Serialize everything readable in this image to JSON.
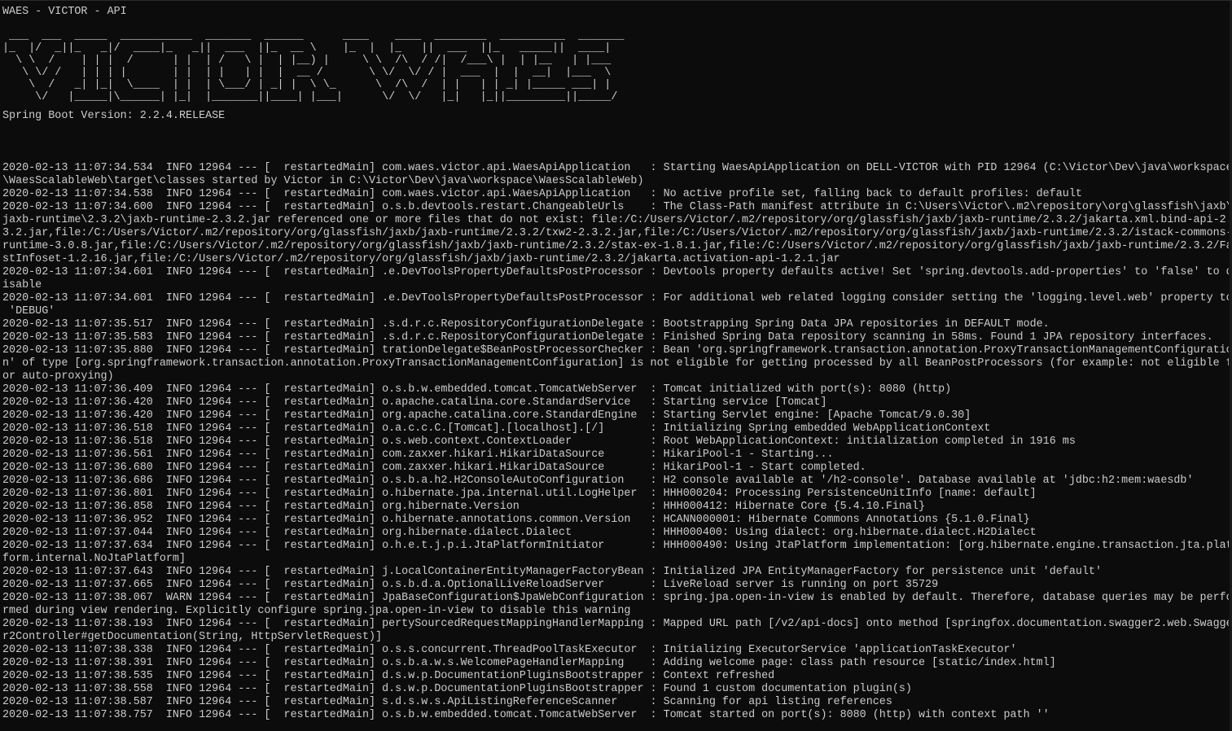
{
  "console": {
    "title": "WAES - VICTOR - API",
    "banner": [
      " ___  ___  _____  ___________  _______  ______      ____    ____  ________  __________  _______ ",
      "|_  |/  _||_   _|/  ____|_   _||  ___  ||_  __ \\    |_  |  |_   ||  ___  ||_   _____||  ____|",
      "  \\ \\  /    | | |  /      | |  | /   \\ |  | |__) |     \\ \\  /\\  / /|  /___\\ |  | |__   | |___  ",
      "   \\ \\/ /   | | | |       | |  | |   | |  |  __ /       \\ \\/  \\/ / |  ___  |  |  __|  |___  \\ ",
      "    \\  /   _| |_|  \\____  | |  | \\___/ | _| |  \\ \\_      \\  /\\  /  | |   | | _| |_____ ___| | ",
      "     \\/   |_____|\\______| |_|  |_______||____| |___|      \\/  \\/   |_|   |_||_________||_____/ "
    ],
    "version": "Spring Boot Version: 2.2.4.RELEASE",
    "log_lines": [
      "2020-02-13 11:07:34.534  INFO 12964 --- [  restartedMain] com.waes.victor.api.WaesApiApplication   : Starting WaesApiApplication on DELL-VICTOR with PID 12964 (C:\\Victor\\Dev\\java\\workspace",
      "\\WaesScalableWeb\\target\\classes started by Victor in C:\\Victor\\Dev\\java\\workspace\\WaesScalableWeb)",
      "2020-02-13 11:07:34.538  INFO 12964 --- [  restartedMain] com.waes.victor.api.WaesApiApplication   : No active profile set, falling back to default profiles: default",
      "2020-02-13 11:07:34.600  INFO 12964 --- [  restartedMain] o.s.b.devtools.restart.ChangeableUrls    : The Class-Path manifest attribute in C:\\Users\\Victor\\.m2\\repository\\org\\glassfish\\jaxb\\",
      "jaxb-runtime\\2.3.2\\jaxb-runtime-2.3.2.jar referenced one or more files that do not exist: file:/C:/Users/Victor/.m2/repository/org/glassfish/jaxb/jaxb-runtime/2.3.2/jakarta.xml.bind-api-2.",
      "3.2.jar,file:/C:/Users/Victor/.m2/repository/org/glassfish/jaxb/jaxb-runtime/2.3.2/txw2-2.3.2.jar,file:/C:/Users/Victor/.m2/repository/org/glassfish/jaxb/jaxb-runtime/2.3.2/istack-commons-",
      "runtime-3.0.8.jar,file:/C:/Users/Victor/.m2/repository/org/glassfish/jaxb/jaxb-runtime/2.3.2/stax-ex-1.8.1.jar,file:/C:/Users/Victor/.m2/repository/org/glassfish/jaxb/jaxb-runtime/2.3.2/Fa",
      "stInfoset-1.2.16.jar,file:/C:/Users/Victor/.m2/repository/org/glassfish/jaxb/jaxb-runtime/2.3.2/jakarta.activation-api-1.2.1.jar",
      "2020-02-13 11:07:34.601  INFO 12964 --- [  restartedMain] .e.DevToolsPropertyDefaultsPostProcessor : Devtools property defaults active! Set 'spring.devtools.add-properties' to 'false' to d",
      "isable",
      "2020-02-13 11:07:34.601  INFO 12964 --- [  restartedMain] .e.DevToolsPropertyDefaultsPostProcessor : For additional web related logging consider setting the 'logging.level.web' property to",
      " 'DEBUG'",
      "2020-02-13 11:07:35.517  INFO 12964 --- [  restartedMain] .s.d.r.c.RepositoryConfigurationDelegate : Bootstrapping Spring Data JPA repositories in DEFAULT mode.",
      "2020-02-13 11:07:35.583  INFO 12964 --- [  restartedMain] .s.d.r.c.RepositoryConfigurationDelegate : Finished Spring Data repository scanning in 58ms. Found 1 JPA repository interfaces.",
      "2020-02-13 11:07:35.880  INFO 12964 --- [  restartedMain] trationDelegate$BeanPostProcessorChecker : Bean 'org.springframework.transaction.annotation.ProxyTransactionManagementConfiguratio",
      "n' of type [org.springframework.transaction.annotation.ProxyTransactionManagementConfiguration] is not eligible for getting processed by all BeanPostProcessors (for example: not eligible f",
      "or auto-proxying)",
      "2020-02-13 11:07:36.409  INFO 12964 --- [  restartedMain] o.s.b.w.embedded.tomcat.TomcatWebServer  : Tomcat initialized with port(s): 8080 (http)",
      "2020-02-13 11:07:36.420  INFO 12964 --- [  restartedMain] o.apache.catalina.core.StandardService   : Starting service [Tomcat]",
      "2020-02-13 11:07:36.420  INFO 12964 --- [  restartedMain] org.apache.catalina.core.StandardEngine  : Starting Servlet engine: [Apache Tomcat/9.0.30]",
      "2020-02-13 11:07:36.518  INFO 12964 --- [  restartedMain] o.a.c.c.C.[Tomcat].[localhost].[/]       : Initializing Spring embedded WebApplicationContext",
      "2020-02-13 11:07:36.518  INFO 12964 --- [  restartedMain] o.s.web.context.ContextLoader            : Root WebApplicationContext: initialization completed in 1916 ms",
      "2020-02-13 11:07:36.561  INFO 12964 --- [  restartedMain] com.zaxxer.hikari.HikariDataSource       : HikariPool-1 - Starting...",
      "2020-02-13 11:07:36.680  INFO 12964 --- [  restartedMain] com.zaxxer.hikari.HikariDataSource       : HikariPool-1 - Start completed.",
      "2020-02-13 11:07:36.686  INFO 12964 --- [  restartedMain] o.s.b.a.h2.H2ConsoleAutoConfiguration    : H2 console available at '/h2-console'. Database available at 'jdbc:h2:mem:waesdb'",
      "2020-02-13 11:07:36.801  INFO 12964 --- [  restartedMain] o.hibernate.jpa.internal.util.LogHelper  : HHH000204: Processing PersistenceUnitInfo [name: default]",
      "2020-02-13 11:07:36.858  INFO 12964 --- [  restartedMain] org.hibernate.Version                    : HHH000412: Hibernate Core {5.4.10.Final}",
      "2020-02-13 11:07:36.952  INFO 12964 --- [  restartedMain] o.hibernate.annotations.common.Version   : HCANN000001: Hibernate Commons Annotations {5.1.0.Final}",
      "2020-02-13 11:07:37.044  INFO 12964 --- [  restartedMain] org.hibernate.dialect.Dialect            : HHH000400: Using dialect: org.hibernate.dialect.H2Dialect",
      "2020-02-13 11:07:37.634  INFO 12964 --- [  restartedMain] o.h.e.t.j.p.i.JtaPlatformInitiator       : HHH000490: Using JtaPlatform implementation: [org.hibernate.engine.transaction.jta.plat",
      "form.internal.NoJtaPlatform]",
      "2020-02-13 11:07:37.643  INFO 12964 --- [  restartedMain] j.LocalContainerEntityManagerFactoryBean : Initialized JPA EntityManagerFactory for persistence unit 'default'",
      "2020-02-13 11:07:37.665  INFO 12964 --- [  restartedMain] o.s.b.d.a.OptionalLiveReloadServer       : LiveReload server is running on port 35729",
      "2020-02-13 11:07:38.067  WARN 12964 --- [  restartedMain] JpaBaseConfiguration$JpaWebConfiguration : spring.jpa.open-in-view is enabled by default. Therefore, database queries may be perfo",
      "rmed during view rendering. Explicitly configure spring.jpa.open-in-view to disable this warning",
      "2020-02-13 11:07:38.193  INFO 12964 --- [  restartedMain] pertySourcedRequestMappingHandlerMapping : Mapped URL path [/v2/api-docs] onto method [springfox.documentation.swagger2.web.Swagge",
      "r2Controller#getDocumentation(String, HttpServletRequest)]",
      "2020-02-13 11:07:38.338  INFO 12964 --- [  restartedMain] o.s.s.concurrent.ThreadPoolTaskExecutor  : Initializing ExecutorService 'applicationTaskExecutor'",
      "2020-02-13 11:07:38.391  INFO 12964 --- [  restartedMain] o.s.b.a.w.s.WelcomePageHandlerMapping    : Adding welcome page: class path resource [static/index.html]",
      "2020-02-13 11:07:38.535  INFO 12964 --- [  restartedMain] d.s.w.p.DocumentationPluginsBootstrapper : Context refreshed",
      "2020-02-13 11:07:38.558  INFO 12964 --- [  restartedMain] d.s.w.p.DocumentationPluginsBootstrapper : Found 1 custom documentation plugin(s)",
      "2020-02-13 11:07:38.587  INFO 12964 --- [  restartedMain] s.d.s.w.s.ApiListingReferenceScanner     : Scanning for api listing references",
      "2020-02-13 11:07:38.757  INFO 12964 --- [  restartedMain] o.s.b.w.embedded.tomcat.TomcatWebServer  : Tomcat started on port(s): 8080 (http) with context path ''"
    ]
  }
}
